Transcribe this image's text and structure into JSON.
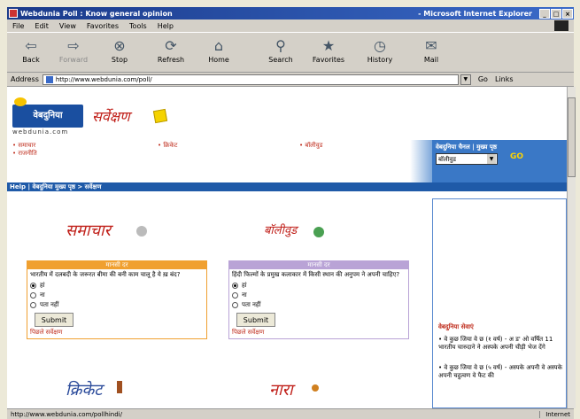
{
  "window": {
    "title_left": "Webdunia Poll : Know general opinion",
    "title_right": "- Microsoft Internet Explorer",
    "controls": [
      "_",
      "□",
      "×"
    ]
  },
  "menu": [
    "File",
    "Edit",
    "View",
    "Favorites",
    "Tools",
    "Help"
  ],
  "toolbar": [
    {
      "label": "Back",
      "icon": "back-arrow-icon",
      "glyph": "⇦"
    },
    {
      "label": "Forward",
      "icon": "forward-arrow-icon",
      "glyph": "⇨"
    },
    {
      "label": "Stop",
      "icon": "stop-icon",
      "glyph": "⊗"
    },
    {
      "label": "Refresh",
      "icon": "refresh-icon",
      "glyph": "⟳"
    },
    {
      "label": "Home",
      "icon": "home-icon",
      "glyph": "⌂"
    },
    {
      "label": "Search",
      "icon": "search-icon",
      "glyph": "⚲"
    },
    {
      "label": "Favorites",
      "icon": "favorites-icon",
      "glyph": "★"
    },
    {
      "label": "History",
      "icon": "history-icon",
      "glyph": "◷"
    },
    {
      "label": "Mail",
      "icon": "mail-icon",
      "glyph": "✉"
    }
  ],
  "address": {
    "label": "Address",
    "value": "http://www.webdunia.com/poll/",
    "go": "Go",
    "links": "Links"
  },
  "site": {
    "logo": "वेबदुनिया",
    "logo_url": "webdunia.com",
    "title": "सर्वेक्षण",
    "nav": [
      "समाचार",
      "क्रिकेट",
      "बॉलीवुड",
      "राजनीति"
    ],
    "panel_label": "वेबदुनिया चैनल | मुख्य पृष्ठ",
    "panel_select": "बॉलीवुड",
    "panel_go": "GO",
    "breadcrumb": "Help | वेबदुनिया मुख्य पृष्ठ > सर्वेक्षण"
  },
  "polls": [
    {
      "section": "समाचार",
      "header": "मानसी दर",
      "question": "भारतीय में दलबदी के जरूरत बीमा की बनी काम चालू है ये ख़ बंद?",
      "options": [
        "हां",
        "ना",
        "पता नहीं"
      ],
      "selected": 0,
      "submit": "Submit",
      "results": "पिछले सर्वेक्षण",
      "color": "#f0a030"
    },
    {
      "section": "बॉलीवुड",
      "header": "मानसी दर",
      "question": "हिंदी फिल्मों के प्रमुख कलाकार में किसी स्थान की अनुपम ने अपनी चाहिए?",
      "options": [
        "हां",
        "ना",
        "पता नहीं"
      ],
      "selected": 0,
      "submit": "Submit",
      "results": "पिछले सर्वेक्षण",
      "color": "#b9a3d6"
    }
  ],
  "bottom_sections": [
    "क्रिकेट",
    "नारा"
  ],
  "sidebar": {
    "title": "वेबदुनिया सेवाएं",
    "items": [
      "• वे कुछ जिया वे छ (१ वर्ष) - अ ड' ओ वर्षित 11 भारतीय चारुदाने ने अस्पके अपनी चीड़ी भेज देंगे",
      "• वे कुछ जिया वे छ (५ वर्ष) - अस्पके अपनी वे अस्पके अपनी चहुत्वण वे फैट की"
    ]
  },
  "status": {
    "text": "http://www.webdunia.com/pollhindi/",
    "zone": "Internet"
  }
}
